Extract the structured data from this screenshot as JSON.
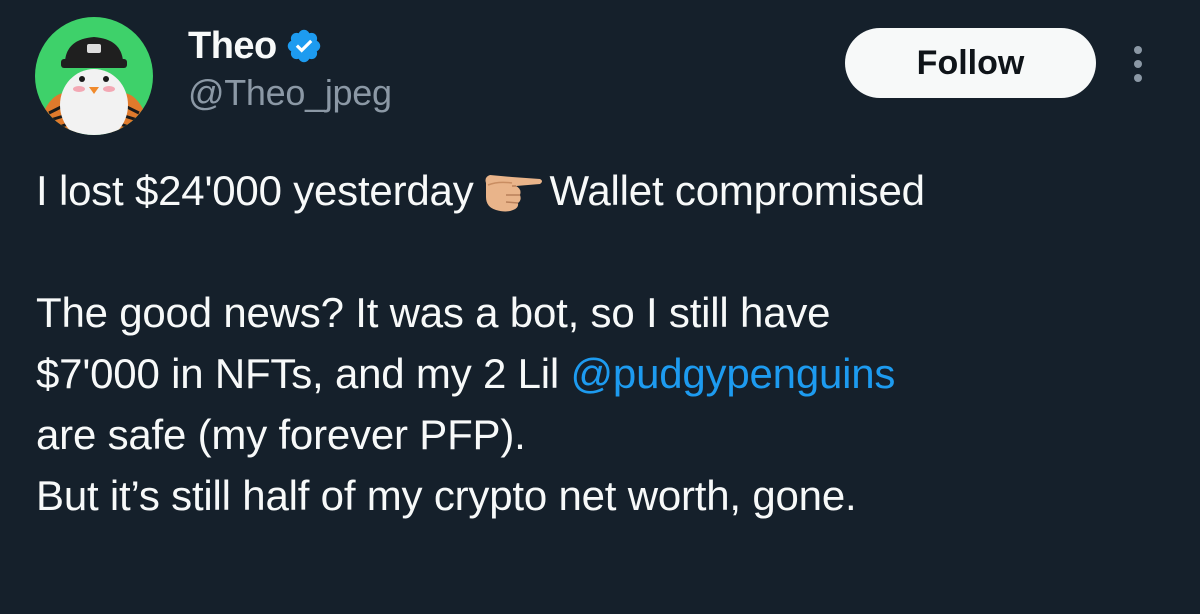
{
  "author": {
    "display_name": "Theo",
    "handle": "@Theo_jpeg",
    "verified": true,
    "verified_icon": "verified-badge-icon"
  },
  "actions": {
    "follow_label": "Follow",
    "more_icon": "more-options-icon"
  },
  "tweet": {
    "line1_before": "I lost $24'000 yesterday",
    "line1_emoji": "backhand-index-pointing-right",
    "line1_after": "Wallet compromised",
    "line2": "The good news? It was a bot, so I still have",
    "line3_before": "$7'000 in NFTs, and my 2 Lil ",
    "line3_mention": "@pudgypenguins",
    "line4": "are safe (my forever PFP).",
    "line5": "But it’s still half of my crypto net worth, gone."
  },
  "colors": {
    "background": "#15202b",
    "text": "#f7f9f9",
    "secondary_text": "#8b98a5",
    "accent": "#1d9bf0",
    "avatar_bg": "#3ed16a"
  }
}
